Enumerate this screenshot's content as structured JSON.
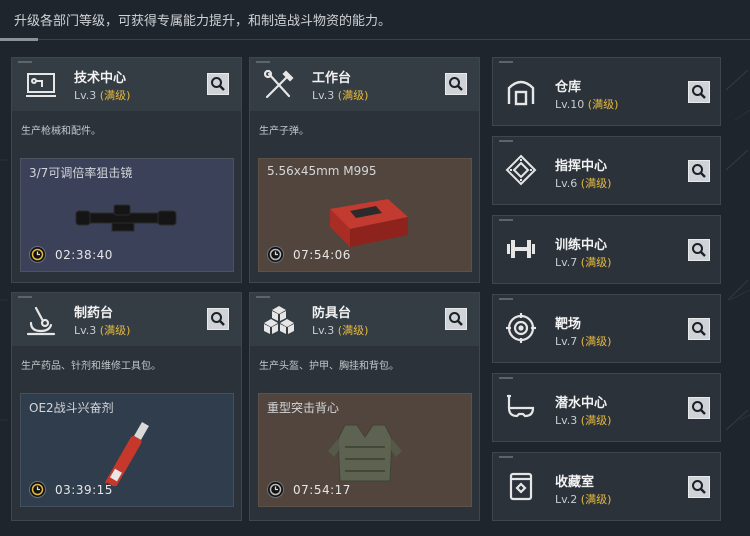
{
  "page": {
    "description": "升级各部门等级，可获得专属能力提升，和制造战斗物资的能力。"
  },
  "level_max_label": "(满级)",
  "cards": [
    {
      "title": "技术中心",
      "level": "Lv.3",
      "desc": "生产枪械和配件。",
      "icon": "computer-icon",
      "craft": {
        "name": "3/7可调倍率狙击镜",
        "time": "02:38:40",
        "image": "scope-image"
      }
    },
    {
      "title": "工作台",
      "level": "Lv.3",
      "desc": "生产子弹。",
      "icon": "tools-icon",
      "craft": {
        "name": "5.56x45mm M995",
        "time": "07:54:06",
        "image": "ammo-box-image"
      }
    },
    {
      "title": "制药台",
      "level": "Lv.3",
      "desc": "生产药品、针剂和维修工具包。",
      "icon": "microscope-icon",
      "craft": {
        "name": "OE2战斗兴奋剂",
        "time": "03:39:15",
        "image": "injector-image"
      }
    },
    {
      "title": "防具台",
      "level": "Lv.3",
      "desc": "生产头盔、护甲、胸挂和背包。",
      "icon": "cubes-icon",
      "craft": {
        "name": "重型突击背心",
        "time": "07:54:17",
        "image": "vest-image"
      }
    }
  ],
  "side": [
    {
      "title": "仓库",
      "level": "Lv.10",
      "icon": "warehouse-icon"
    },
    {
      "title": "指挥中心",
      "level": "Lv.6",
      "icon": "chip-icon"
    },
    {
      "title": "训练中心",
      "level": "Lv.7",
      "icon": "dumbbell-icon"
    },
    {
      "title": "靶场",
      "level": "Lv.7",
      "icon": "target-icon"
    },
    {
      "title": "潜水中心",
      "level": "Lv.3",
      "icon": "diving-mask-icon"
    },
    {
      "title": "收藏室",
      "level": "Lv.2",
      "icon": "collection-icon"
    }
  ]
}
